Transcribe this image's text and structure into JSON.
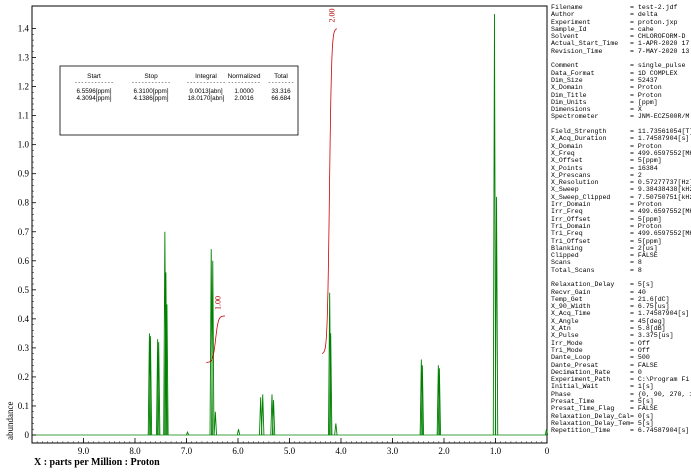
{
  "chart_data": {
    "type": "line",
    "title": "",
    "xlabel": "X : parts per Million : Proton",
    "ylabel": "abundance",
    "xlim": [
      10.0,
      0.0
    ],
    "ylim": [
      0.0,
      1.45
    ],
    "x_ticks": [
      "9.0",
      "8.0",
      "7.0",
      "6.0",
      "5.0",
      "4.0",
      "3.0",
      "2.0",
      "1.0",
      "0"
    ],
    "y_ticks": [
      "0",
      "0.1",
      "0.2",
      "0.3",
      "0.4",
      "0.5",
      "0.6",
      "0.7",
      "0.8",
      "0.9",
      "1.0",
      "1.1",
      "1.2",
      "1.3",
      "1.4"
    ],
    "grid": false,
    "line_color": "#008000",
    "integral_color": "#cc0000",
    "peaks": [
      {
        "ppm": 7.72,
        "height": 0.35
      },
      {
        "ppm": 7.7,
        "height": 0.34
      },
      {
        "ppm": 7.56,
        "height": 0.33
      },
      {
        "ppm": 7.54,
        "height": 0.32
      },
      {
        "ppm": 7.42,
        "height": 0.7
      },
      {
        "ppm": 7.4,
        "height": 0.56
      },
      {
        "ppm": 7.38,
        "height": 0.45
      },
      {
        "ppm": 6.98,
        "height": 0.01
      },
      {
        "ppm": 6.52,
        "height": 0.64
      },
      {
        "ppm": 6.49,
        "height": 0.6
      },
      {
        "ppm": 6.44,
        "height": 0.08
      },
      {
        "ppm": 5.99,
        "height": 0.02
      },
      {
        "ppm": 5.56,
        "height": 0.13
      },
      {
        "ppm": 5.52,
        "height": 0.14
      },
      {
        "ppm": 5.34,
        "height": 0.14
      },
      {
        "ppm": 5.31,
        "height": 0.12
      },
      {
        "ppm": 4.22,
        "height": 0.49
      },
      {
        "ppm": 4.2,
        "height": 0.35
      },
      {
        "ppm": 4.1,
        "height": 0.04
      },
      {
        "ppm": 2.44,
        "height": 0.26
      },
      {
        "ppm": 2.42,
        "height": 0.24
      },
      {
        "ppm": 2.11,
        "height": 0.24
      },
      {
        "ppm": 2.09,
        "height": 0.23
      },
      {
        "ppm": 1.02,
        "height": 1.45
      },
      {
        "ppm": 0.98,
        "height": 0.82
      },
      {
        "ppm": 0.01,
        "height": 0.02
      }
    ],
    "integral_curves": [
      {
        "start_ppm": 6.5596,
        "stop_ppm": 6.31,
        "label": "1.00",
        "base": 0.25,
        "rise": 0.16
      },
      {
        "start_ppm": 4.3094,
        "stop_ppm": 4.1386,
        "label": "2.00",
        "base": 0.28,
        "rise": 1.12
      }
    ]
  },
  "integral_table": {
    "headers": [
      "Start",
      "Stop",
      "Integral",
      "Normalized",
      "Total"
    ],
    "separator": [
      "------------",
      "------------",
      "------------",
      "----------",
      "--------"
    ],
    "rows": [
      [
        "6.5596[ppm]",
        "6.3100[ppm]",
        "9.0013[abn]",
        "1.0000",
        "33.316"
      ],
      [
        "4.3094[ppm]",
        "4.1386[ppm]",
        "18.0170[abn]",
        "2.0016",
        "66.684"
      ]
    ]
  },
  "parameters": [
    {
      "key": "Filename",
      "value": "= test-2.jdf"
    },
    {
      "key": "Author",
      "value": "= delta"
    },
    {
      "key": "Experiment",
      "value": "= proton.jxp"
    },
    {
      "key": "Sample_Id",
      "value": "= cahe"
    },
    {
      "key": "Solvent",
      "value": "= CHLOROFORM-D"
    },
    {
      "key": "Actual_Start_Time",
      "value": "= 1-APR-2020 17"
    },
    {
      "key": "Revision_Time",
      "value": "= 7-MAY-2020 13"
    },
    {
      "gap": true
    },
    {
      "key": "Comment",
      "value": "= single_pulse"
    },
    {
      "key": "Data_Format",
      "value": "= 1D COMPLEX"
    },
    {
      "key": "Dim_Size",
      "value": "= 52437"
    },
    {
      "key": "X_Domain",
      "value": "= Proton"
    },
    {
      "key": "Dim_Title",
      "value": "= Proton"
    },
    {
      "key": "Dim_Units",
      "value": "= [ppm]"
    },
    {
      "key": "Dimensions",
      "value": "= X"
    },
    {
      "key": "Spectrometer",
      "value": "= JNM-ECZ500R/M"
    },
    {
      "gap": true
    },
    {
      "key": "Field_Strength",
      "value": "= 11.73561054[T]"
    },
    {
      "key": "X_Acq_Duration",
      "value": "= 1.74587904[s]"
    },
    {
      "key": "X_Domain",
      "value": "= Proton"
    },
    {
      "key": "X_Freq",
      "value": "= 499.6597552[MH"
    },
    {
      "key": "X_Offset",
      "value": "= 5[ppm]"
    },
    {
      "key": "X_Points",
      "value": "= 16384"
    },
    {
      "key": "X_Prescans",
      "value": "= 2"
    },
    {
      "key": "X_Resolution",
      "value": "= 0.57277737[Hz]"
    },
    {
      "key": "X_Sweep",
      "value": "= 9.38438438[kHz"
    },
    {
      "key": "X_Sweep_Clipped",
      "value": "= 7.50750751[kHz"
    },
    {
      "key": "Irr_Domain",
      "value": "= Proton"
    },
    {
      "key": "Irr_Freq",
      "value": "= 499.6597552[MH"
    },
    {
      "key": "Irr_Offset",
      "value": "= 5[ppm]"
    },
    {
      "key": "Tri_Domain",
      "value": "= Proton"
    },
    {
      "key": "Tri_Freq",
      "value": "= 499.6597552[MH"
    },
    {
      "key": "Tri_Offset",
      "value": "= 5[ppm]"
    },
    {
      "key": "Blanking",
      "value": "= 2[us]"
    },
    {
      "key": "Clipped",
      "value": "= FALSE"
    },
    {
      "key": "Scans",
      "value": "= 8"
    },
    {
      "key": "Total_Scans",
      "value": "= 8"
    },
    {
      "gap": true
    },
    {
      "key": "Relaxation_Delay",
      "value": "= 5[s]"
    },
    {
      "key": "Recvr_Gain",
      "value": "= 40"
    },
    {
      "key": "Temp_Get",
      "value": "= 21.6[dC]"
    },
    {
      "key": "X_90_Width",
      "value": "= 6.75[us]"
    },
    {
      "key": "X_Acq_Time",
      "value": "= 1.74587904[s]"
    },
    {
      "key": "X_Angle",
      "value": "= 45[deg]"
    },
    {
      "key": "X_Atn",
      "value": "= 5.8[dB]"
    },
    {
      "key": "X_Pulse",
      "value": "= 3.375[us]"
    },
    {
      "key": "Irr_Mode",
      "value": "= Off"
    },
    {
      "key": "Tri_Mode",
      "value": "= Off"
    },
    {
      "key": "Dante_Loop",
      "value": "= 500"
    },
    {
      "key": "Dante_Presat",
      "value": "= FALSE"
    },
    {
      "key": "Decimation_Rate",
      "value": "= 0"
    },
    {
      "key": "Experiment_Path",
      "value": "= C:\\Program Fi"
    },
    {
      "key": "Initial_Wait",
      "value": "= 1[s]"
    },
    {
      "key": "Phase",
      "value": "= {0, 90, 270, 1"
    },
    {
      "key": "Presat_Time",
      "value": "= 5[s]"
    },
    {
      "key": "Presat_Time_Flag",
      "value": "= FALSE"
    },
    {
      "key": "Relaxation_Delay_Calc",
      "value": "= 0[s]"
    },
    {
      "key": "Relaxation_Delay_Temp",
      "value": "= 5[s]"
    },
    {
      "key": "Repetition_Time",
      "value": "= 6.74587904[s]"
    }
  ]
}
